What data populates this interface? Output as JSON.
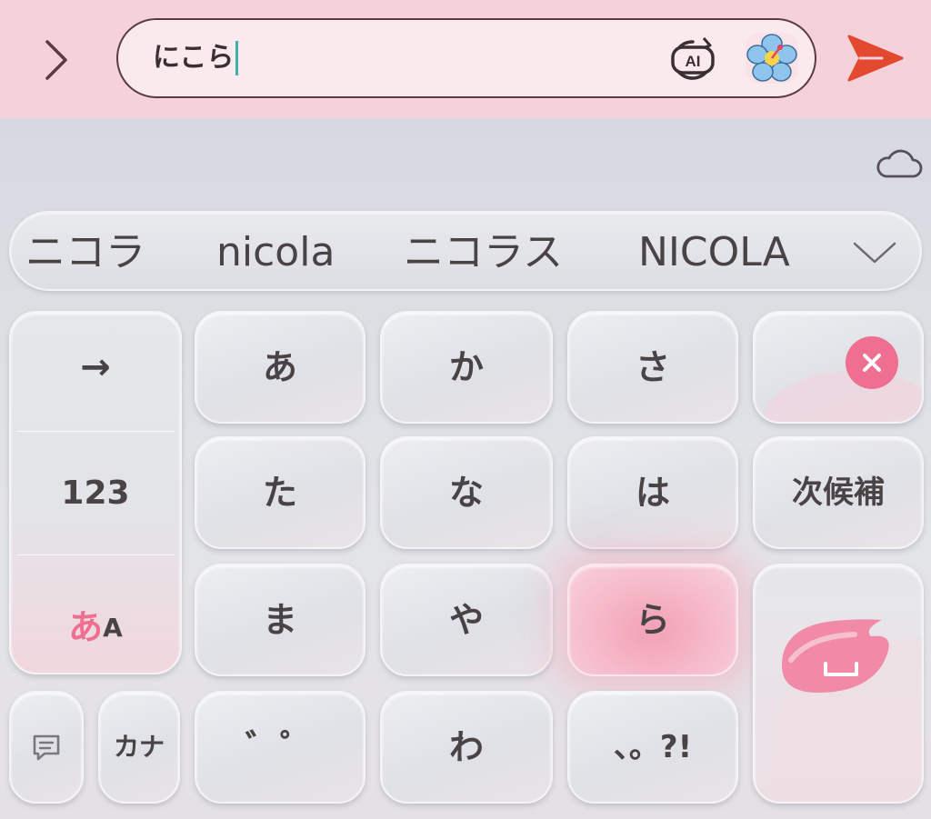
{
  "input": {
    "value": "にこら"
  },
  "toolbar": {
    "ai_label": "AI"
  },
  "candidates": [
    {
      "text": "ニコラ"
    },
    {
      "text": "nicola"
    },
    {
      "text": "ニコラス"
    },
    {
      "text": "NICOLA"
    }
  ],
  "keys": {
    "a": "あ",
    "ka": "か",
    "sa": "さ",
    "ta": "た",
    "na": "な",
    "ha": "は",
    "ma": "ま",
    "ya": "や",
    "ra": "ら",
    "dakuten": "゛゜",
    "wa": "わ",
    "punct": "、。?!",
    "next_candidate": "次候補",
    "arrow": "→",
    "num": "123",
    "kana_small": "カナ",
    "mode_a": "あ",
    "mode_A": "A"
  },
  "colors": {
    "topbar": "#f5d2d9",
    "accent_pink": "#ee6f8f",
    "send_red": "#e2492f",
    "caret": "#3fb3a3"
  },
  "icons": {
    "back": "chevron-right-icon",
    "ai": "ai-badge-icon",
    "sticker": "hibiscus-icon",
    "send": "send-icon",
    "cloud": "cloud-icon",
    "expand": "chevron-down-icon",
    "delete": "close-icon",
    "enter": "return-icon",
    "comment": "comment-icon"
  }
}
